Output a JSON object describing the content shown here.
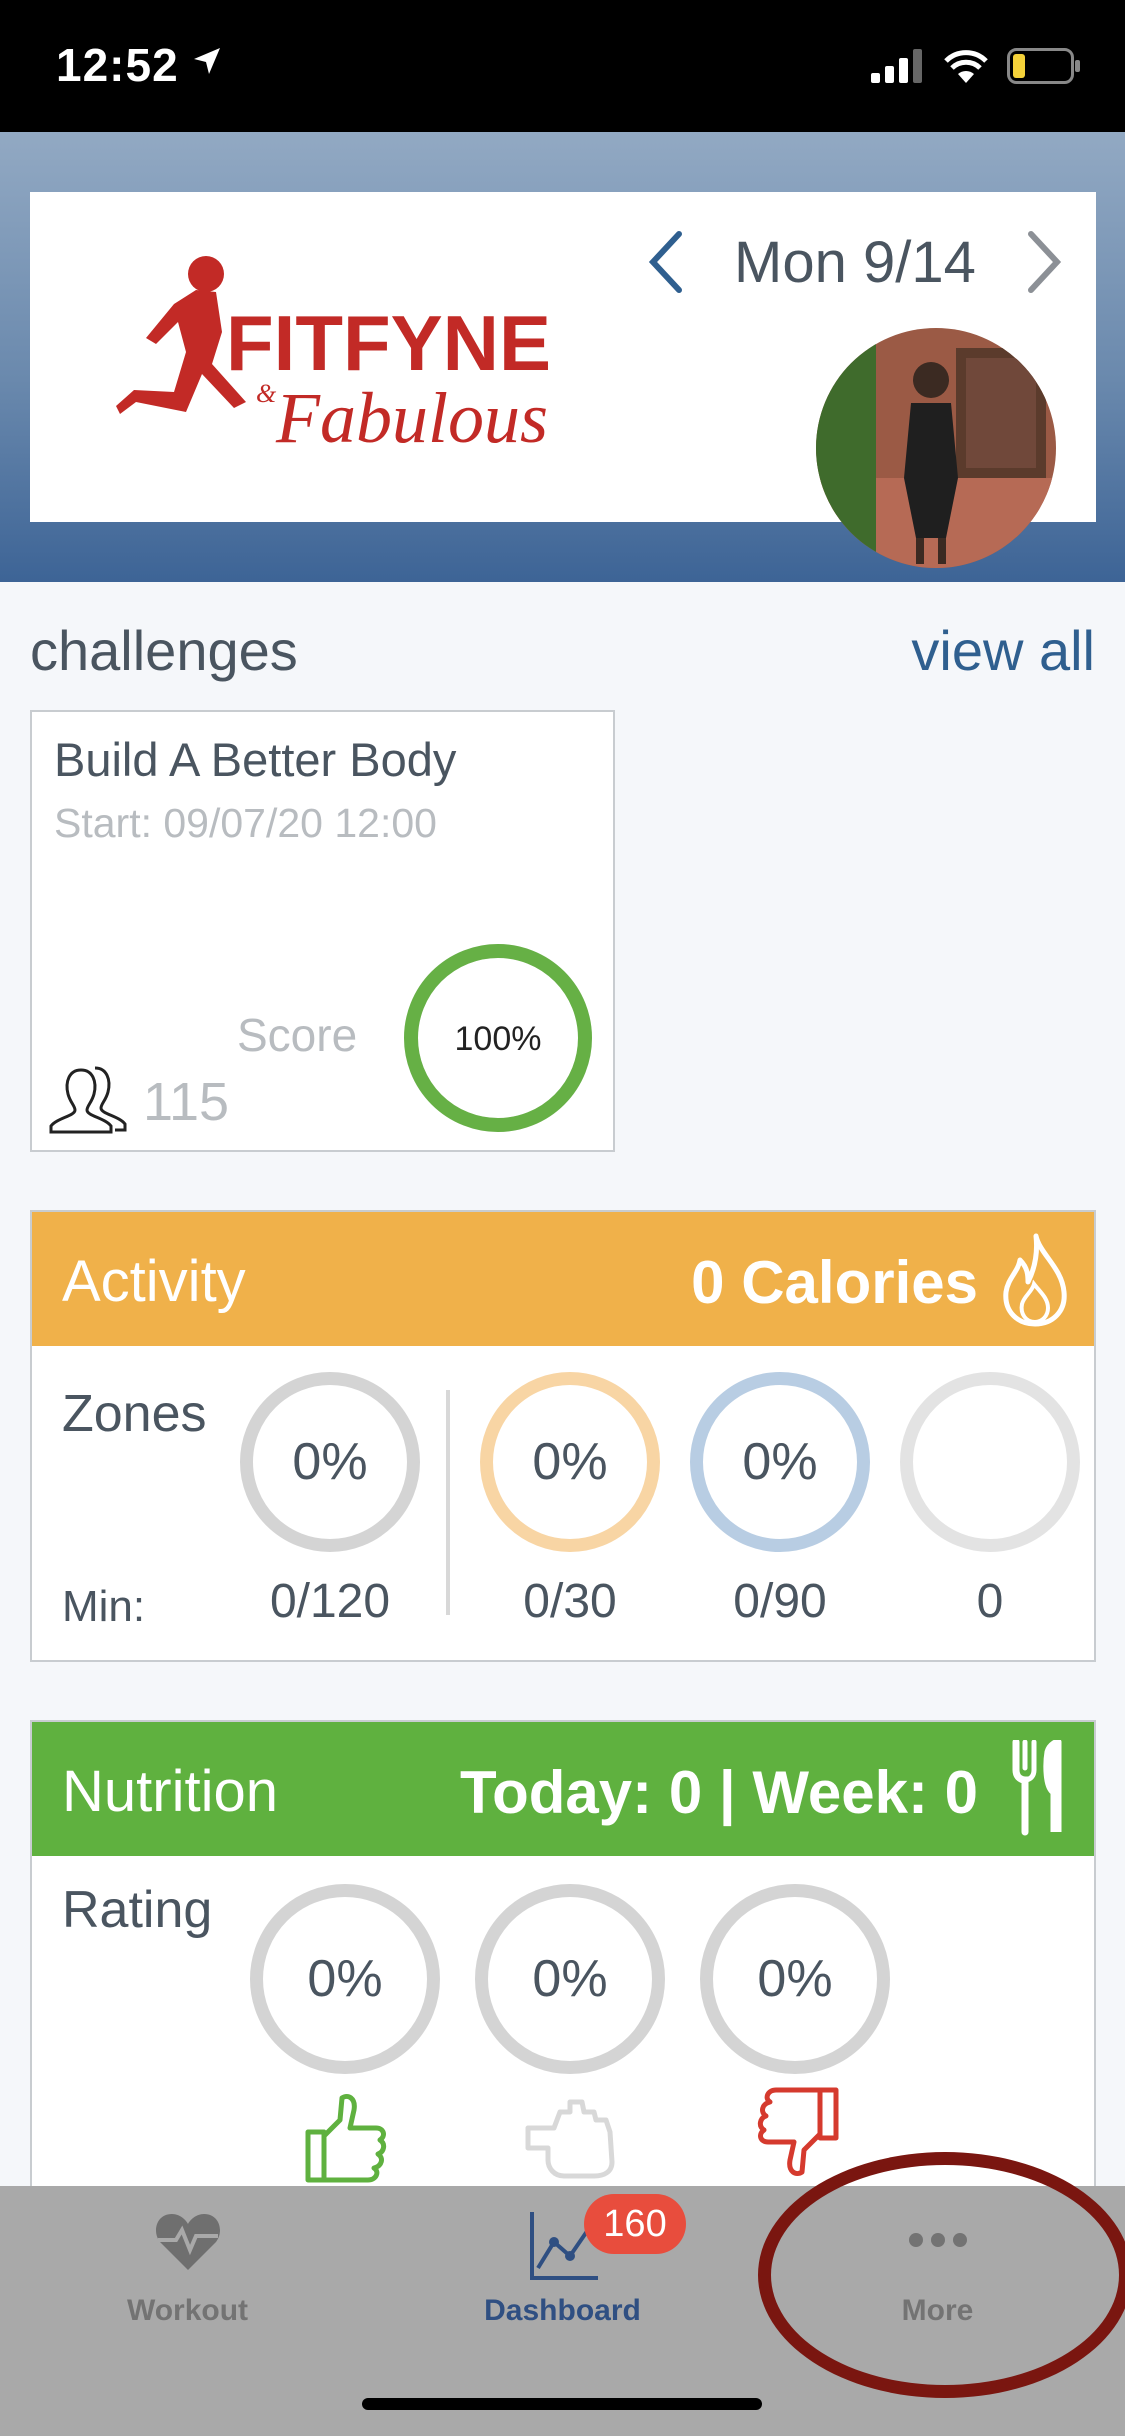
{
  "status_bar": {
    "time": "12:52"
  },
  "header": {
    "logo": {
      "line1": "FITFYNE",
      "ampersand": "&",
      "line2": "Fabulous"
    },
    "date": "Mon 9/14"
  },
  "challenges": {
    "title": "challenges",
    "view_all": "view all",
    "card": {
      "name": "Build A Better Body",
      "start": "Start: 09/07/20 12:00",
      "score_label": "Score",
      "score": "100%",
      "score_fraction": 1.0,
      "members": "115"
    }
  },
  "activity": {
    "title": "Activity",
    "calories": "0 Calories",
    "zones_label": "Zones",
    "min_label": "Min:",
    "zones": [
      {
        "pct": "0%",
        "min": "0/120",
        "color": "#d4d4d4"
      },
      {
        "pct": "0%",
        "min": "0/30",
        "color": "#f8d5a4"
      },
      {
        "pct": "0%",
        "min": "0/90",
        "color": "#b8cde3"
      },
      {
        "pct": "",
        "min": "0",
        "color": "#e3e3e3"
      }
    ],
    "header_color": "#f0b14a"
  },
  "nutrition": {
    "title": "Nutrition",
    "summary": "Today: 0 | Week: 0",
    "rating_label": "Rating",
    "ratings": [
      {
        "pct": "0%",
        "icon": "thumbs-up-icon",
        "color": "#5fb13f"
      },
      {
        "pct": "0%",
        "icon": "hand-neutral-icon",
        "color": "#d8d8d8"
      },
      {
        "pct": "0%",
        "icon": "thumbs-down-icon",
        "color": "#d53a2e"
      }
    ],
    "header_color": "#5fb13f"
  },
  "tab_bar": {
    "tabs": [
      {
        "label": "Workout",
        "icon": "heart-pulse-icon"
      },
      {
        "label": "Dashboard",
        "icon": "chart-line-icon",
        "badge": "160"
      },
      {
        "label": "More",
        "icon": "more-dots-icon"
      }
    ],
    "active": "Dashboard"
  }
}
